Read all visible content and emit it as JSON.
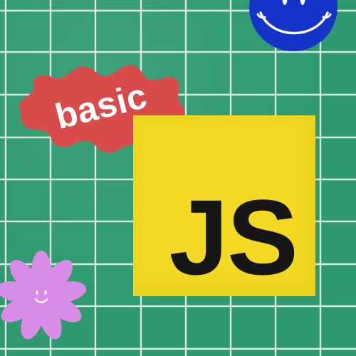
{
  "badge": {
    "label": "basic"
  },
  "logo": {
    "text": "JS"
  },
  "colors": {
    "background": "#2f9a70",
    "grid": "#e8f3ec",
    "badge": "#d94b4b",
    "logo": "#f3d923",
    "logo_text": "#161616",
    "smiley": "#1433c9",
    "flower": "#d98be8"
  },
  "icons": {
    "smiley": "smiley-face-icon",
    "flower": "flower-icon"
  }
}
